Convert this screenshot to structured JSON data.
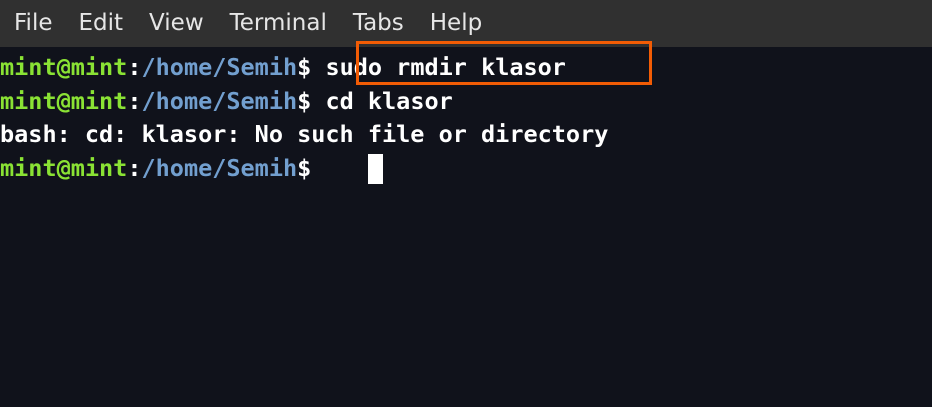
{
  "menu": {
    "items": [
      "File",
      "Edit",
      "View",
      "Terminal",
      "Tabs",
      "Help"
    ]
  },
  "terminal": {
    "lines": [
      {
        "user": "mint@mint",
        "sep": ":",
        "path": "/home/Semih",
        "prompt": "$ ",
        "text": "sudo rmdir klasor"
      },
      {
        "user": "mint@mint",
        "sep": ":",
        "path": "/home/Semih",
        "prompt": "$ ",
        "text": "cd klasor"
      },
      {
        "output": "bash: cd: klasor: No such file or directory"
      },
      {
        "user": "mint@mint",
        "sep": ":",
        "path": "/home/Semih",
        "prompt": "$ ",
        "text": ""
      }
    ]
  },
  "colors": {
    "user": "#8ae234",
    "path": "#729fcf",
    "highlight": "#f25c05",
    "background": "#10121b",
    "menubar": "#303030"
  }
}
